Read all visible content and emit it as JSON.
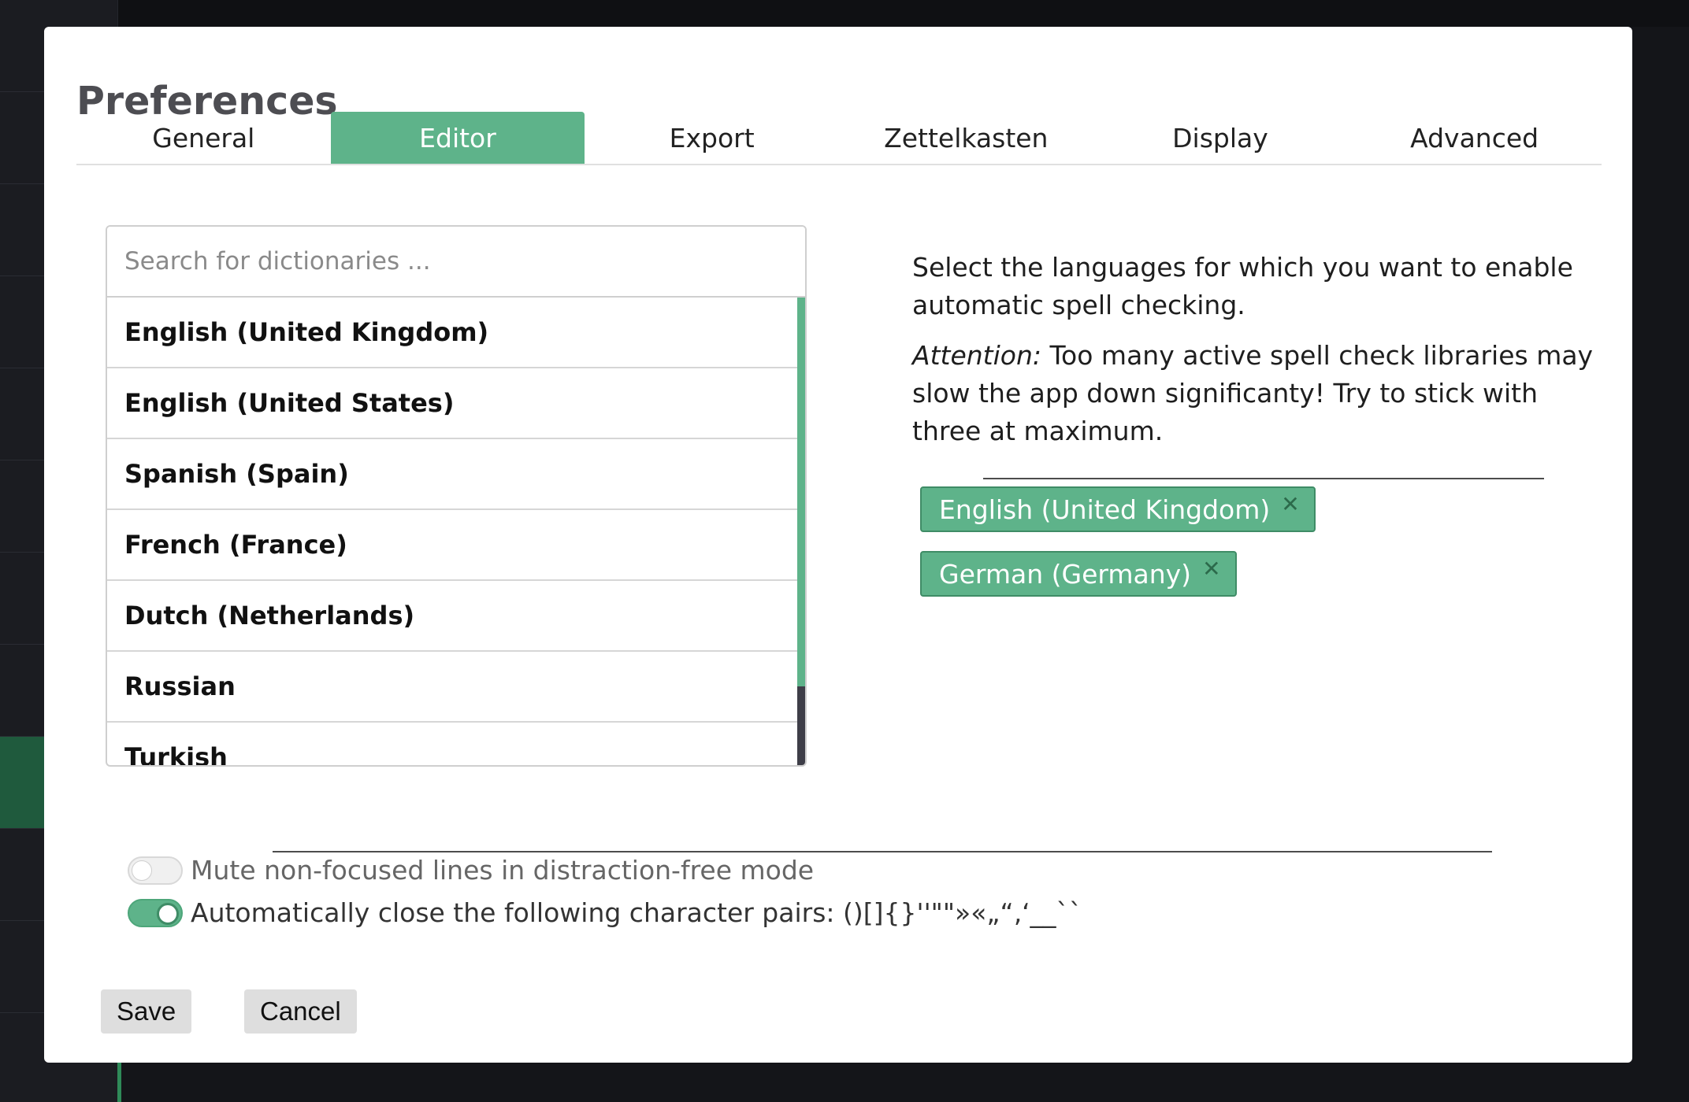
{
  "dialog": {
    "title": "Preferences"
  },
  "tabs": [
    {
      "label": "General"
    },
    {
      "label": "Editor",
      "active": true
    },
    {
      "label": "Export"
    },
    {
      "label": "Zettelkasten"
    },
    {
      "label": "Display"
    },
    {
      "label": "Advanced"
    }
  ],
  "dictionaries": {
    "search_placeholder": "Search for dictionaries ...",
    "items": [
      {
        "label": "English (United Kingdom)"
      },
      {
        "label": "English (United States)"
      },
      {
        "label": "Spanish (Spain)"
      },
      {
        "label": "French (France)"
      },
      {
        "label": "Dutch (Netherlands)"
      },
      {
        "label": "Russian"
      },
      {
        "label": "Turkish"
      }
    ]
  },
  "info": {
    "description": "Select the languages for which you want to enable automatic spell checking.",
    "attention_label": "Attention:",
    "attention_text": " Too many active spell check libraries may slow the app down significanty! Try to stick with three at maximum."
  },
  "active_dictionaries": [
    {
      "label": "English (United Kingdom)",
      "remove_glyph": "✕"
    },
    {
      "label": "German (Germany)",
      "remove_glyph": "✕"
    }
  ],
  "options": {
    "mute_lines": {
      "label": "Mute non-focused lines in distraction-free mode",
      "checked": false
    },
    "autoclose": {
      "label": "Automatically close the following character pairs: ()[]{}''\"\"»«„“‚‘__``",
      "checked": true
    }
  },
  "buttons": {
    "save": "Save",
    "cancel": "Cancel"
  },
  "colors": {
    "accent": "#5eb38a",
    "modal_bg": "#ffffff",
    "backdrop": "#141519"
  }
}
